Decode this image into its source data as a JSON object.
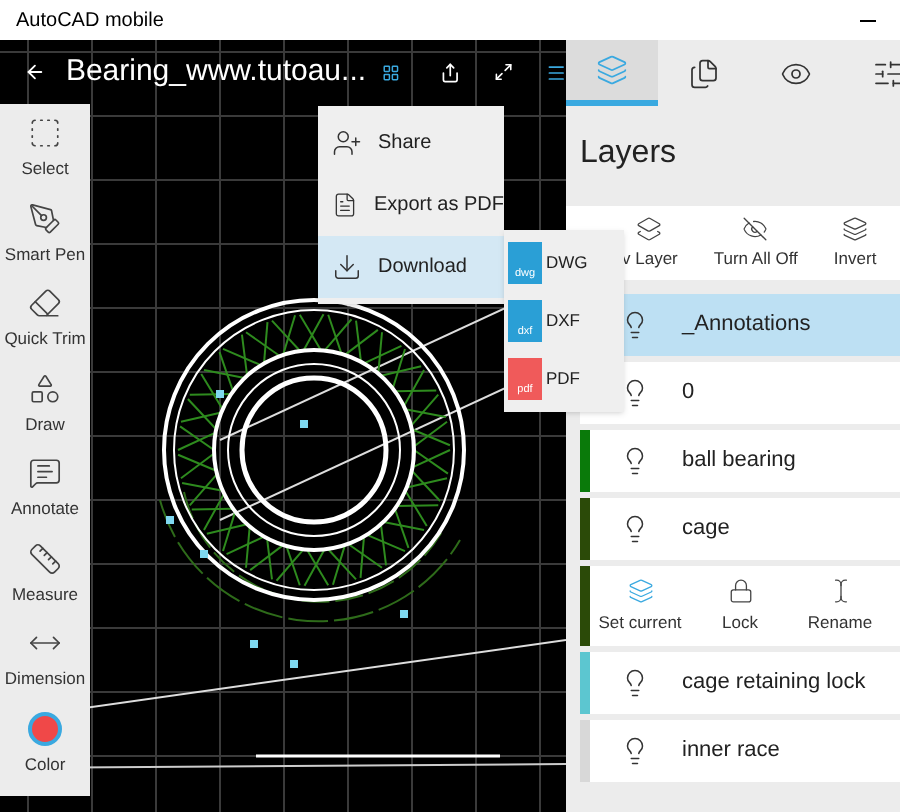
{
  "window": {
    "title": "AutoCAD mobile"
  },
  "toolbar": {
    "file_title": "Bearing_www.tutoau..."
  },
  "tools": [
    {
      "label": "Select"
    },
    {
      "label": "Smart Pen"
    },
    {
      "label": "Quick Trim"
    },
    {
      "label": "Draw"
    },
    {
      "label": "Annotate"
    },
    {
      "label": "Measure"
    },
    {
      "label": "Dimension"
    },
    {
      "label": "Color"
    }
  ],
  "menu": {
    "items": [
      {
        "label": "Share",
        "selected": false
      },
      {
        "label": "Export as PDF",
        "selected": false
      },
      {
        "label": "Download",
        "selected": true
      }
    ]
  },
  "submenu": {
    "items": [
      {
        "label": "DWG",
        "tag": "dwg",
        "color": "#2a9fd6"
      },
      {
        "label": "DXF",
        "tag": "dxf",
        "color": "#2a9fd6"
      },
      {
        "label": "PDF",
        "tag": "pdf",
        "color": "#f05a5a"
      }
    ]
  },
  "panel_tabs": [
    {
      "selected": true
    },
    {
      "selected": false
    },
    {
      "selected": false
    },
    {
      "selected": false
    }
  ],
  "layers": {
    "title": "Layers",
    "actions": [
      "v Layer",
      "Turn All Off",
      "Invert"
    ],
    "items": [
      {
        "name": "_Annotations",
        "selected": true
      },
      {
        "name": "0",
        "color": "#ffffff",
        "selected": false
      },
      {
        "name": "ball bearing",
        "color": "#0a7a0a",
        "selected": false
      },
      {
        "name": "cage",
        "color": "#2b4a08",
        "selected": false,
        "actions": [
          "Set current",
          "Lock",
          "Rename"
        ]
      },
      {
        "name": "cage retaining lock",
        "color": "#5cc6d0",
        "selected": false
      },
      {
        "name": "inner race",
        "color": "#d8d8d8",
        "selected": false
      }
    ]
  }
}
